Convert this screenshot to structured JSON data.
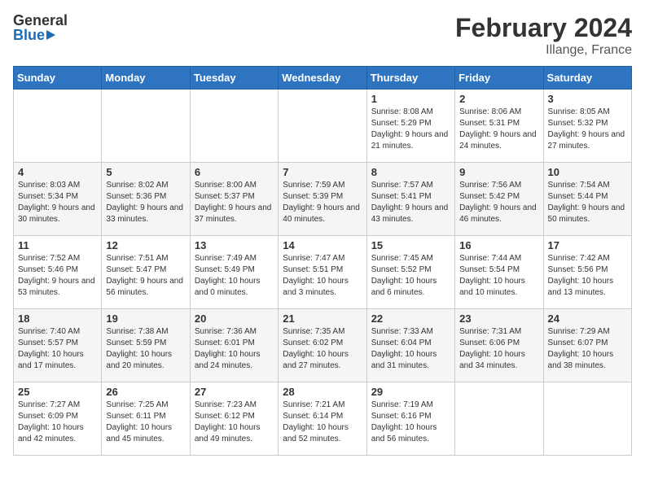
{
  "logo": {
    "general": "General",
    "blue": "Blue"
  },
  "title": "February 2024",
  "subtitle": "Illange, France",
  "days_header": [
    "Sunday",
    "Monday",
    "Tuesday",
    "Wednesday",
    "Thursday",
    "Friday",
    "Saturday"
  ],
  "weeks": [
    [
      {
        "num": "",
        "info": ""
      },
      {
        "num": "",
        "info": ""
      },
      {
        "num": "",
        "info": ""
      },
      {
        "num": "",
        "info": ""
      },
      {
        "num": "1",
        "info": "Sunrise: 8:08 AM\nSunset: 5:29 PM\nDaylight: 9 hours\nand 21 minutes."
      },
      {
        "num": "2",
        "info": "Sunrise: 8:06 AM\nSunset: 5:31 PM\nDaylight: 9 hours\nand 24 minutes."
      },
      {
        "num": "3",
        "info": "Sunrise: 8:05 AM\nSunset: 5:32 PM\nDaylight: 9 hours\nand 27 minutes."
      }
    ],
    [
      {
        "num": "4",
        "info": "Sunrise: 8:03 AM\nSunset: 5:34 PM\nDaylight: 9 hours\nand 30 minutes."
      },
      {
        "num": "5",
        "info": "Sunrise: 8:02 AM\nSunset: 5:36 PM\nDaylight: 9 hours\nand 33 minutes."
      },
      {
        "num": "6",
        "info": "Sunrise: 8:00 AM\nSunset: 5:37 PM\nDaylight: 9 hours\nand 37 minutes."
      },
      {
        "num": "7",
        "info": "Sunrise: 7:59 AM\nSunset: 5:39 PM\nDaylight: 9 hours\nand 40 minutes."
      },
      {
        "num": "8",
        "info": "Sunrise: 7:57 AM\nSunset: 5:41 PM\nDaylight: 9 hours\nand 43 minutes."
      },
      {
        "num": "9",
        "info": "Sunrise: 7:56 AM\nSunset: 5:42 PM\nDaylight: 9 hours\nand 46 minutes."
      },
      {
        "num": "10",
        "info": "Sunrise: 7:54 AM\nSunset: 5:44 PM\nDaylight: 9 hours\nand 50 minutes."
      }
    ],
    [
      {
        "num": "11",
        "info": "Sunrise: 7:52 AM\nSunset: 5:46 PM\nDaylight: 9 hours\nand 53 minutes."
      },
      {
        "num": "12",
        "info": "Sunrise: 7:51 AM\nSunset: 5:47 PM\nDaylight: 9 hours\nand 56 minutes."
      },
      {
        "num": "13",
        "info": "Sunrise: 7:49 AM\nSunset: 5:49 PM\nDaylight: 10 hours\nand 0 minutes."
      },
      {
        "num": "14",
        "info": "Sunrise: 7:47 AM\nSunset: 5:51 PM\nDaylight: 10 hours\nand 3 minutes."
      },
      {
        "num": "15",
        "info": "Sunrise: 7:45 AM\nSunset: 5:52 PM\nDaylight: 10 hours\nand 6 minutes."
      },
      {
        "num": "16",
        "info": "Sunrise: 7:44 AM\nSunset: 5:54 PM\nDaylight: 10 hours\nand 10 minutes."
      },
      {
        "num": "17",
        "info": "Sunrise: 7:42 AM\nSunset: 5:56 PM\nDaylight: 10 hours\nand 13 minutes."
      }
    ],
    [
      {
        "num": "18",
        "info": "Sunrise: 7:40 AM\nSunset: 5:57 PM\nDaylight: 10 hours\nand 17 minutes."
      },
      {
        "num": "19",
        "info": "Sunrise: 7:38 AM\nSunset: 5:59 PM\nDaylight: 10 hours\nand 20 minutes."
      },
      {
        "num": "20",
        "info": "Sunrise: 7:36 AM\nSunset: 6:01 PM\nDaylight: 10 hours\nand 24 minutes."
      },
      {
        "num": "21",
        "info": "Sunrise: 7:35 AM\nSunset: 6:02 PM\nDaylight: 10 hours\nand 27 minutes."
      },
      {
        "num": "22",
        "info": "Sunrise: 7:33 AM\nSunset: 6:04 PM\nDaylight: 10 hours\nand 31 minutes."
      },
      {
        "num": "23",
        "info": "Sunrise: 7:31 AM\nSunset: 6:06 PM\nDaylight: 10 hours\nand 34 minutes."
      },
      {
        "num": "24",
        "info": "Sunrise: 7:29 AM\nSunset: 6:07 PM\nDaylight: 10 hours\nand 38 minutes."
      }
    ],
    [
      {
        "num": "25",
        "info": "Sunrise: 7:27 AM\nSunset: 6:09 PM\nDaylight: 10 hours\nand 42 minutes."
      },
      {
        "num": "26",
        "info": "Sunrise: 7:25 AM\nSunset: 6:11 PM\nDaylight: 10 hours\nand 45 minutes."
      },
      {
        "num": "27",
        "info": "Sunrise: 7:23 AM\nSunset: 6:12 PM\nDaylight: 10 hours\nand 49 minutes."
      },
      {
        "num": "28",
        "info": "Sunrise: 7:21 AM\nSunset: 6:14 PM\nDaylight: 10 hours\nand 52 minutes."
      },
      {
        "num": "29",
        "info": "Sunrise: 7:19 AM\nSunset: 6:16 PM\nDaylight: 10 hours\nand 56 minutes."
      },
      {
        "num": "",
        "info": ""
      },
      {
        "num": "",
        "info": ""
      }
    ]
  ]
}
